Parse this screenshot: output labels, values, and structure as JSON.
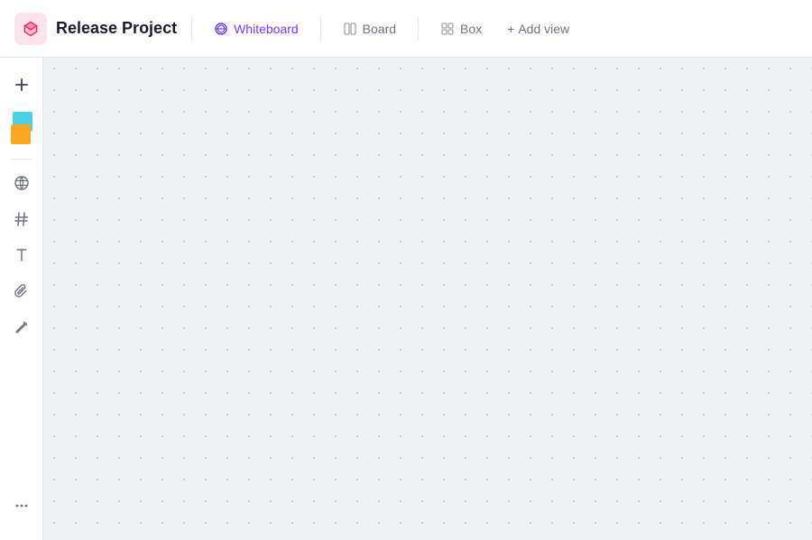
{
  "header": {
    "project_title": "Release Project",
    "tabs": [
      {
        "id": "whiteboard",
        "label": "Whiteboard",
        "active": true
      },
      {
        "id": "board",
        "label": "Board",
        "active": false
      },
      {
        "id": "box",
        "label": "Box",
        "active": false
      }
    ],
    "add_view_label": "Add view"
  },
  "sidebar": {
    "tools": [
      {
        "id": "add",
        "icon": "plus-icon",
        "label": "Add"
      },
      {
        "id": "sticky",
        "icon": "sticky-icon",
        "label": "Sticky notes"
      },
      {
        "id": "globe",
        "icon": "globe-icon",
        "label": "Globe"
      },
      {
        "id": "hashtag",
        "icon": "hashtag-icon",
        "label": "Hashtag"
      },
      {
        "id": "text",
        "icon": "text-icon",
        "label": "Text"
      },
      {
        "id": "attachment",
        "icon": "attachment-icon",
        "label": "Attachment"
      },
      {
        "id": "draw",
        "icon": "draw-icon",
        "label": "Draw"
      },
      {
        "id": "more",
        "icon": "more-icon",
        "label": "More options"
      }
    ]
  },
  "canvas": {
    "background_color": "#f0f1f5"
  }
}
